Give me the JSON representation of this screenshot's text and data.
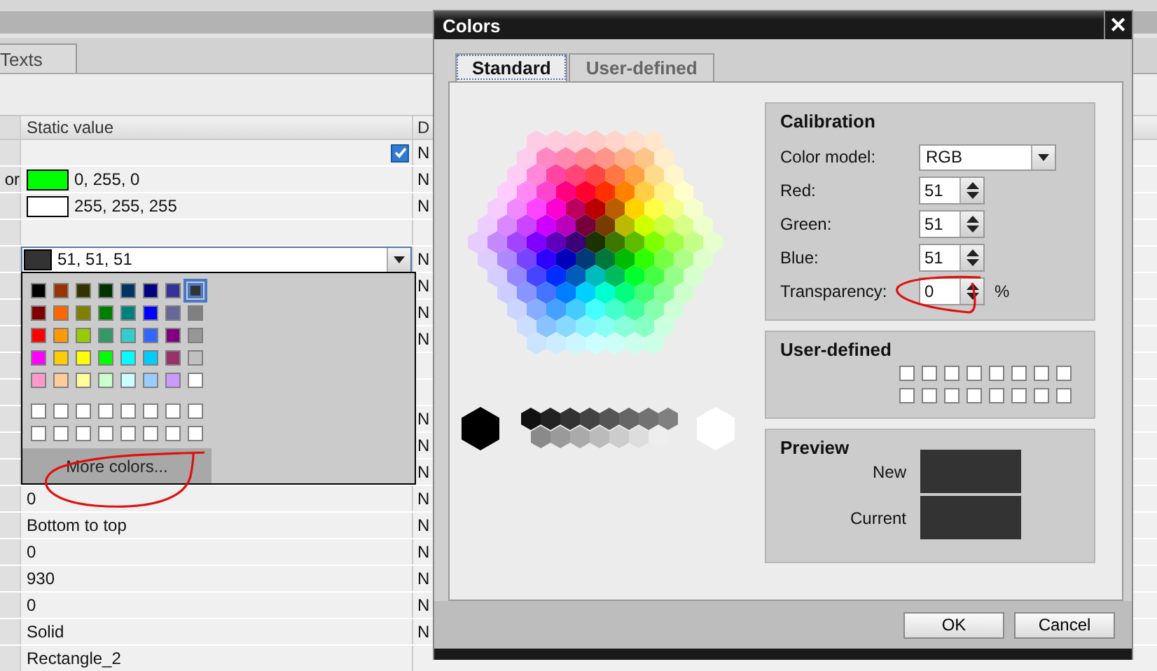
{
  "background_tab": {
    "label": "Texts"
  },
  "property_table": {
    "columns": [
      "Static value",
      "D"
    ],
    "rows": [
      {
        "kind": "checkbox",
        "checked": true,
        "dynamic": "N"
      },
      {
        "kind": "color",
        "name": "or",
        "color": "#00ff00",
        "value": "0, 255, 0",
        "dynamic": "N"
      },
      {
        "kind": "color",
        "color": "#ffffff",
        "value": "255, 255, 255",
        "dynamic": "N"
      },
      {
        "kind": "blank"
      },
      {
        "kind": "color_dropdown",
        "color": "#333333",
        "value": "51, 51, 51",
        "dynamic": "N"
      },
      {
        "kind": "covered",
        "dynamic": "N"
      },
      {
        "kind": "covered",
        "dynamic": "N"
      },
      {
        "kind": "covered",
        "dynamic": "N"
      },
      {
        "kind": "blank"
      },
      {
        "kind": "blank"
      },
      {
        "kind": "covered",
        "dynamic": "N"
      },
      {
        "kind": "covered",
        "dynamic": "N"
      },
      {
        "kind": "covered",
        "dynamic": "N"
      },
      {
        "kind": "text",
        "value": "0",
        "dynamic": "N"
      },
      {
        "kind": "text",
        "value": "Bottom to top",
        "dynamic": "N"
      },
      {
        "kind": "text",
        "value": "0",
        "dynamic": "N"
      },
      {
        "kind": "text",
        "value": "930",
        "dynamic": "N"
      },
      {
        "kind": "text",
        "value": "0",
        "dynamic": "N"
      },
      {
        "kind": "text",
        "value": "Solid",
        "dynamic": "N"
      },
      {
        "kind": "text",
        "value": "Rectangle_2"
      }
    ]
  },
  "palette": {
    "colors": [
      {
        "color": "#000000",
        "selected": false
      },
      {
        "color": "#993300",
        "selected": false
      },
      {
        "color": "#333300",
        "selected": false
      },
      {
        "color": "#003300",
        "selected": false
      },
      {
        "color": "#003366",
        "selected": false
      },
      {
        "color": "#000080",
        "selected": false
      },
      {
        "color": "#333399",
        "selected": false
      },
      {
        "color": "#333333",
        "selected": true
      },
      {
        "color": "#800000",
        "selected": false
      },
      {
        "color": "#ff6600",
        "selected": false
      },
      {
        "color": "#808000",
        "selected": false
      },
      {
        "color": "#008000",
        "selected": false
      },
      {
        "color": "#008080",
        "selected": false
      },
      {
        "color": "#0000ff",
        "selected": false
      },
      {
        "color": "#666699",
        "selected": false
      },
      {
        "color": "#808080",
        "selected": false
      },
      {
        "color": "#ff0000",
        "selected": false
      },
      {
        "color": "#ff9900",
        "selected": false
      },
      {
        "color": "#99cc00",
        "selected": false
      },
      {
        "color": "#339966",
        "selected": false
      },
      {
        "color": "#33cccc",
        "selected": false
      },
      {
        "color": "#3366ff",
        "selected": false
      },
      {
        "color": "#800080",
        "selected": false
      },
      {
        "color": "#969696",
        "selected": false
      },
      {
        "color": "#ff00ff",
        "selected": false
      },
      {
        "color": "#ffcc00",
        "selected": false
      },
      {
        "color": "#ffff00",
        "selected": false
      },
      {
        "color": "#00ff00",
        "selected": false
      },
      {
        "color": "#00ffff",
        "selected": false
      },
      {
        "color": "#00ccff",
        "selected": false
      },
      {
        "color": "#993366",
        "selected": false
      },
      {
        "color": "#c0c0c0",
        "selected": false
      },
      {
        "color": "#ff99cc",
        "selected": false
      },
      {
        "color": "#ffcc99",
        "selected": false
      },
      {
        "color": "#ffff99",
        "selected": false
      },
      {
        "color": "#ccffcc",
        "selected": false
      },
      {
        "color": "#ccffff",
        "selected": false
      },
      {
        "color": "#99ccff",
        "selected": false
      },
      {
        "color": "#cc99ff",
        "selected": false
      },
      {
        "color": "#ffffff",
        "selected": false
      }
    ],
    "custom_colors": [
      {
        "color": "#ffffff"
      },
      {
        "color": "#ffffff"
      },
      {
        "color": "#ffffff"
      },
      {
        "color": "#ffffff"
      },
      {
        "color": "#ffffff"
      },
      {
        "color": "#ffffff"
      },
      {
        "color": "#ffffff"
      },
      {
        "color": "#ffffff"
      },
      {
        "color": "#ffffff"
      },
      {
        "color": "#ffffff"
      },
      {
        "color": "#ffffff"
      },
      {
        "color": "#ffffff"
      },
      {
        "color": "#ffffff"
      },
      {
        "color": "#ffffff"
      },
      {
        "color": "#ffffff"
      },
      {
        "color": "#ffffff"
      }
    ],
    "more_button": "More colors..."
  },
  "dialog": {
    "title": "Colors",
    "close": "✕",
    "tabs": [
      {
        "label": "Standard",
        "selected": true
      },
      {
        "label": "User-defined",
        "selected": false
      }
    ],
    "calibration": {
      "title": "Calibration",
      "color_model": {
        "label": "Color model:",
        "value": "RGB"
      },
      "spinners": [
        {
          "label": "Red:",
          "value": "51"
        },
        {
          "label": "Green:",
          "value": "51"
        },
        {
          "label": "Blue:",
          "value": "51"
        },
        {
          "label": "Transparency:",
          "value": "0",
          "unit": "%"
        }
      ]
    },
    "user_defined": {
      "title": "User-defined",
      "colors": [
        {
          "color": "#ffffff"
        },
        {
          "color": "#ffffff"
        },
        {
          "color": "#ffffff"
        },
        {
          "color": "#ffffff"
        },
        {
          "color": "#ffffff"
        },
        {
          "color": "#ffffff"
        },
        {
          "color": "#ffffff"
        },
        {
          "color": "#ffffff"
        },
        {
          "color": "#ffffff"
        },
        {
          "color": "#ffffff"
        },
        {
          "color": "#ffffff"
        },
        {
          "color": "#ffffff"
        },
        {
          "color": "#ffffff"
        },
        {
          "color": "#ffffff"
        },
        {
          "color": "#ffffff"
        },
        {
          "color": "#ffffff"
        }
      ]
    },
    "preview": {
      "title": "Preview",
      "swatches": [
        {
          "label": "New",
          "color": "#333333"
        },
        {
          "label": "Current",
          "color": "#333333"
        }
      ]
    },
    "buttons": [
      "OK",
      "Cancel"
    ]
  }
}
